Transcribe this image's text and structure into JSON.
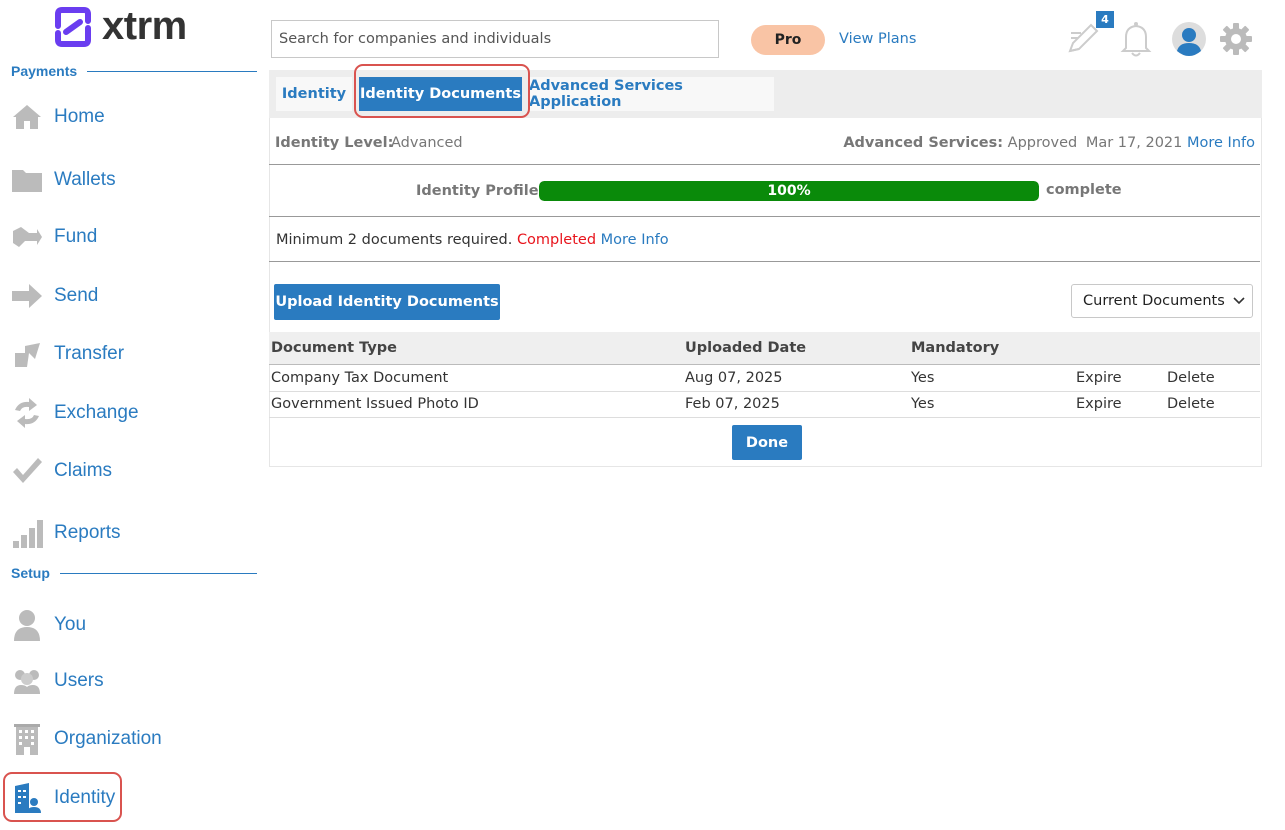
{
  "app": {
    "logo_text": "xtrm",
    "brand_color": "#6a3df0"
  },
  "header": {
    "search_placeholder": "Search for companies and individuals",
    "plan_badge": "Pro",
    "view_plans": "View Plans",
    "notes_count": "4",
    "icons": [
      "edit-notes-icon",
      "bell-icon",
      "profile-avatar-icon",
      "gear-icon"
    ]
  },
  "sidebar": {
    "payments_heading": "Payments",
    "setup_heading": "Setup",
    "payments": [
      {
        "label": "Home",
        "icon": "home-icon"
      },
      {
        "label": "Wallets",
        "icon": "folder-icon"
      },
      {
        "label": "Fund",
        "icon": "fund-icon"
      },
      {
        "label": "Send",
        "icon": "send-arrow-icon"
      },
      {
        "label": "Transfer",
        "icon": "transfer-icon"
      },
      {
        "label": "Exchange",
        "icon": "exchange-icon"
      },
      {
        "label": "Claims",
        "icon": "checkmark-icon"
      },
      {
        "label": "Reports",
        "icon": "bar-chart-icon"
      }
    ],
    "setup": [
      {
        "label": "You",
        "icon": "person-icon"
      },
      {
        "label": "Users",
        "icon": "users-icon"
      },
      {
        "label": "Organization",
        "icon": "building-icon"
      },
      {
        "label": "Identity",
        "icon": "identity-icon",
        "active": true
      }
    ]
  },
  "tabs": [
    {
      "label": "Identity"
    },
    {
      "label": "Identity Documents",
      "active": true
    },
    {
      "label": "Advanced Services Application"
    }
  ],
  "identity": {
    "level_label": "Identity Level:",
    "level_value": "Advanced",
    "adv_label": "Advanced Services:",
    "adv_status": "Approved",
    "adv_date": "Mar 17, 2021",
    "more_info": "More Info",
    "profile_label": "Identity Profile",
    "progress_text": "100%",
    "progress_value": 100,
    "complete_text": "complete",
    "requirement_text": "Minimum 2 documents required.",
    "requirement_status": "Completed",
    "requirement_more": "More Info"
  },
  "documents": {
    "upload_button": "Upload Identity Documents",
    "filter_selected": "Current Documents",
    "columns": [
      "Document Type",
      "Uploaded Date",
      "Mandatory"
    ],
    "rows": [
      {
        "type": "Company Tax Document",
        "date": "Aug 07, 2025",
        "mandatory": "Yes",
        "expire": "Expire",
        "delete": "Delete"
      },
      {
        "type": "Government Issued Photo ID",
        "date": "Feb 07, 2025",
        "mandatory": "Yes",
        "expire": "Expire",
        "delete": "Delete"
      }
    ],
    "done_button": "Done"
  }
}
